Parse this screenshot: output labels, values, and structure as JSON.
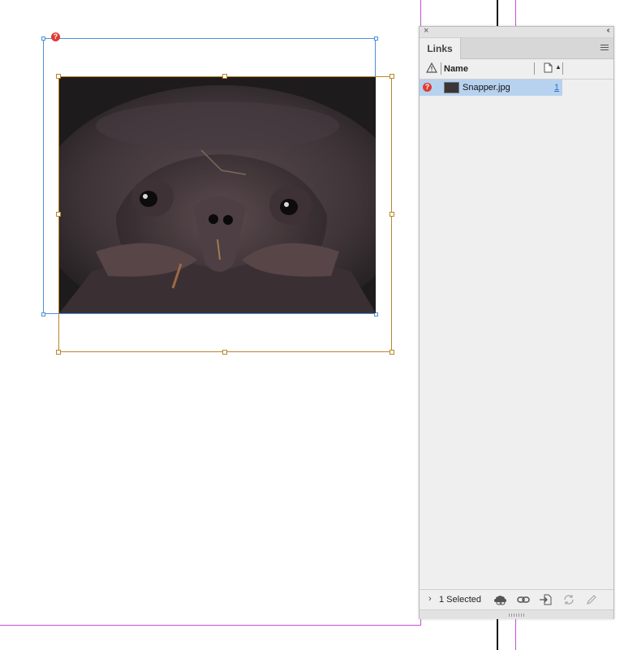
{
  "image": {
    "file_name": "Snapper.jpg",
    "status": "missing",
    "status_symbol": "?",
    "description": "close-up photo of a snapping turtle face"
  },
  "links_panel": {
    "close_symbol": "×",
    "collapse_symbol": "‹‹",
    "tab_label": "Links",
    "columns": {
      "status_icon": "warning-icon",
      "name": "Name",
      "page_icon": "page-icon",
      "sort_symbol": "▲"
    },
    "rows": [
      {
        "status_symbol": "?",
        "name": "Snapper.jpg",
        "page": "1",
        "selected": true
      }
    ],
    "footer": {
      "expand_symbol": "›",
      "selection_text": "1 Selected",
      "icons": [
        "relink-cc-libraries-icon",
        "relink-icon",
        "go-to-link-icon",
        "update-link-icon",
        "edit-original-icon"
      ]
    }
  },
  "colors": {
    "selection_blue": "#4a90d9",
    "image_frame_gold": "#b8862e",
    "guide_magenta": "#c64fd6",
    "missing_red": "#e03a30",
    "row_highlight": "#b7d2ee"
  }
}
